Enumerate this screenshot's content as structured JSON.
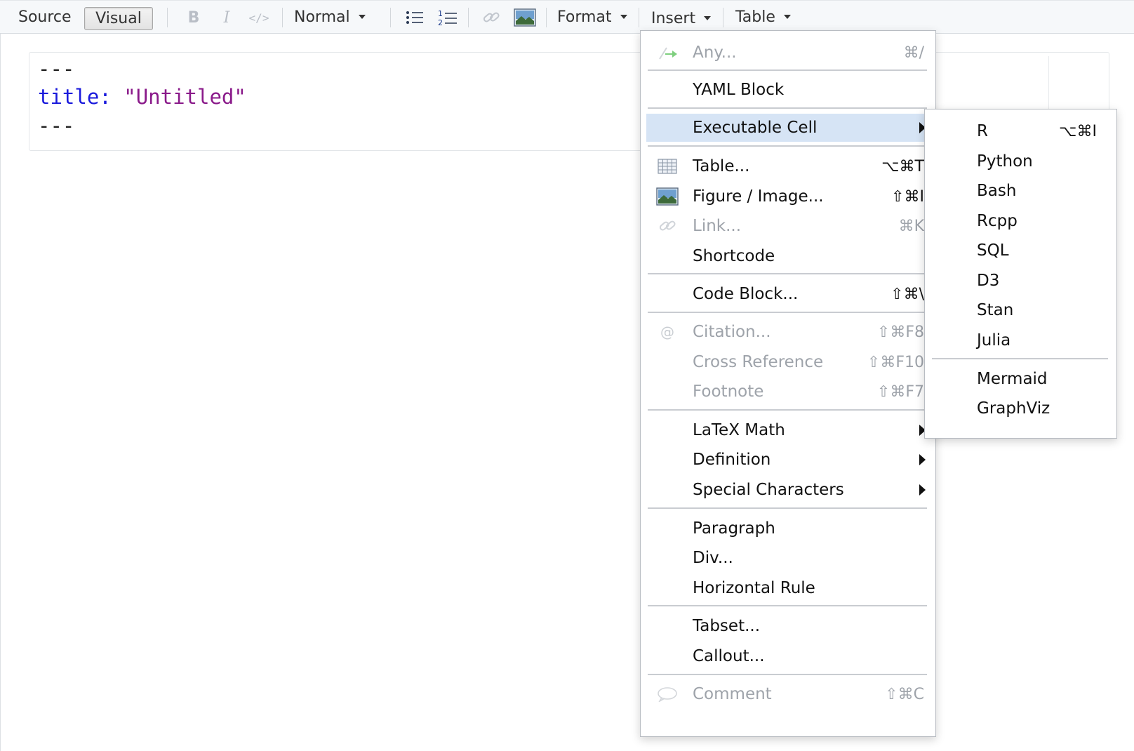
{
  "toolbar": {
    "source_label": "Source",
    "visual_label": "Visual",
    "bold_label": "B",
    "italic_label": "I",
    "code_label": "</>",
    "style_select": "Normal",
    "format_label": "Format",
    "insert_label": "Insert",
    "table_label": "Table"
  },
  "editor": {
    "dash_open": "---",
    "yaml_key": "title:",
    "yaml_value": "\"Untitled\"",
    "dash_close": "---"
  },
  "insert_menu": {
    "any": {
      "label": "Any...",
      "shortcut": "⌘/"
    },
    "yaml_block": {
      "label": "YAML Block"
    },
    "executable_cell": {
      "label": "Executable Cell"
    },
    "table": {
      "label": "Table...",
      "shortcut": "⌥⌘T"
    },
    "figure": {
      "label": "Figure / Image...",
      "shortcut": "⇧⌘I"
    },
    "link": {
      "label": "Link...",
      "shortcut": "⌘K"
    },
    "shortcode": {
      "label": "Shortcode"
    },
    "code_block": {
      "label": "Code Block...",
      "shortcut": "⇧⌘\\"
    },
    "citation": {
      "label": "Citation...",
      "shortcut": "⇧⌘F8"
    },
    "cross_reference": {
      "label": "Cross Reference",
      "shortcut": "⇧⌘F10"
    },
    "footnote": {
      "label": "Footnote",
      "shortcut": "⇧⌘F7"
    },
    "latex_math": {
      "label": "LaTeX Math"
    },
    "definition": {
      "label": "Definition"
    },
    "special_characters": {
      "label": "Special Characters"
    },
    "paragraph": {
      "label": "Paragraph"
    },
    "div": {
      "label": "Div..."
    },
    "horizontal_rule": {
      "label": "Horizontal Rule"
    },
    "tabset": {
      "label": "Tabset..."
    },
    "callout": {
      "label": "Callout..."
    },
    "comment": {
      "label": "Comment",
      "shortcut": "⇧⌘C"
    }
  },
  "cell_menu": {
    "r": {
      "label": "R",
      "shortcut": "⌥⌘I"
    },
    "python": {
      "label": "Python"
    },
    "bash": {
      "label": "Bash"
    },
    "rcpp": {
      "label": "Rcpp"
    },
    "sql": {
      "label": "SQL"
    },
    "d3": {
      "label": "D3"
    },
    "stan": {
      "label": "Stan"
    },
    "julia": {
      "label": "Julia"
    },
    "mermaid": {
      "label": "Mermaid"
    },
    "graphviz": {
      "label": "GraphViz"
    }
  },
  "colors": {
    "highlight": "#d6e4f5",
    "yaml_key": "#1a1adc",
    "yaml_string": "#8a1a8a",
    "disabled_text": "#9ea3aa"
  },
  "icons": [
    "bold-icon",
    "italic-icon",
    "code-icon",
    "bullet-list-icon",
    "numbered-list-icon",
    "link-icon",
    "image-icon",
    "table-grid-icon",
    "image-icon",
    "link-icon",
    "at-icon",
    "comment-icon",
    "any-arrow-icon"
  ]
}
